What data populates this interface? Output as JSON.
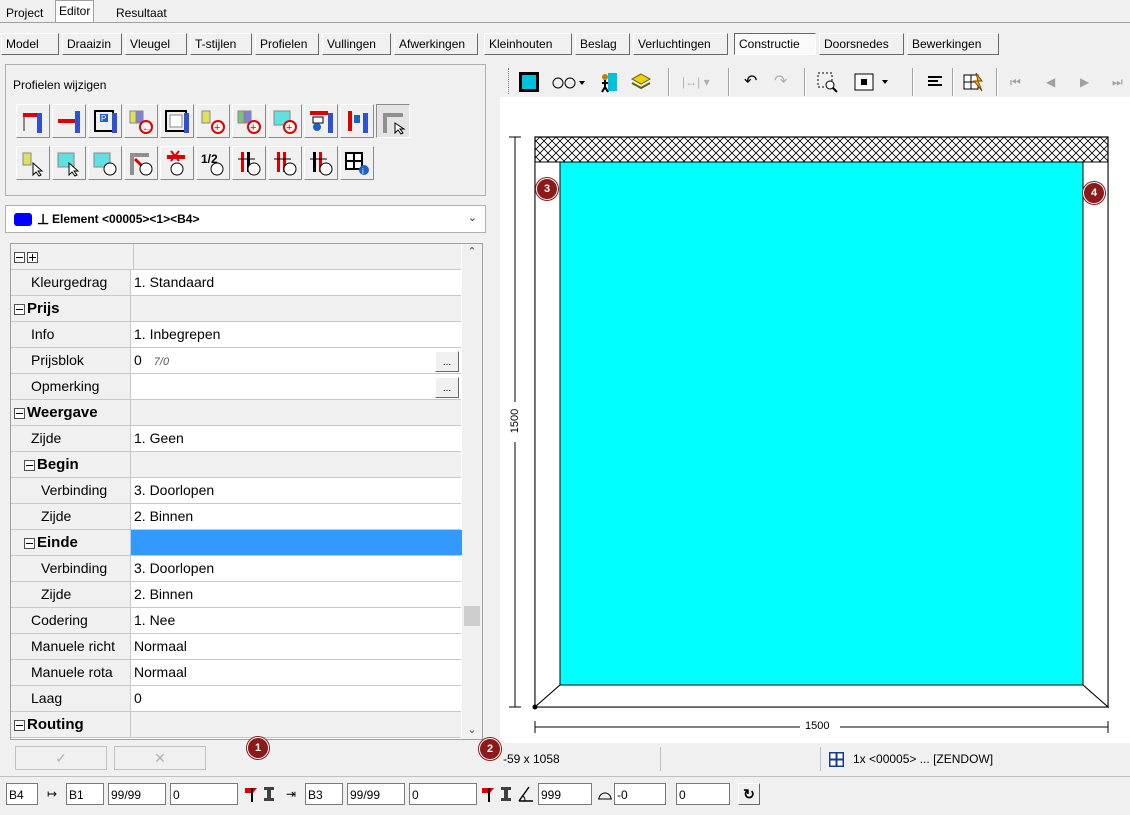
{
  "top_tabs": [
    "Project",
    "Editor",
    "Resultaat"
  ],
  "active_top_tab": "Editor",
  "module_tabs": [
    "Model",
    "Draaizin",
    "Vleugel",
    "T-stijlen",
    "Profielen",
    "Vullingen",
    "Afwerkingen",
    "Kleinhouten",
    "Beslag",
    "Verluchtingen",
    "Constructie",
    "Doorsnedes",
    "Bewerkingen"
  ],
  "active_module_tab": "Constructie",
  "left_panel": {
    "title": "Profielen wijzigen",
    "element_dropdown": "Element <00005><1><B4>"
  },
  "property_grid": {
    "rows": [
      {
        "name": "Kleurgedrag",
        "value": "1. Standaard",
        "type": "prop",
        "indent": 1
      },
      {
        "name": "Prijs",
        "value": "",
        "type": "cat",
        "indent": 0
      },
      {
        "name": "Info",
        "value": "1. Inbegrepen",
        "type": "prop",
        "indent": 1
      },
      {
        "name": "Prijsblok",
        "value": "0",
        "extra": "7/0",
        "type": "prop",
        "indent": 1,
        "button": "..."
      },
      {
        "name": "Opmerking",
        "value": "",
        "type": "prop",
        "indent": 1,
        "button": "..."
      },
      {
        "name": "Weergave",
        "value": "",
        "type": "cat",
        "indent": 0
      },
      {
        "name": "Zijde",
        "value": "1. Geen",
        "type": "prop",
        "indent": 1
      },
      {
        "name": "Begin",
        "value": "",
        "type": "cat",
        "indent": 1
      },
      {
        "name": "Verbinding",
        "value": "3. Doorlopen",
        "type": "prop",
        "indent": 2
      },
      {
        "name": "Zijde",
        "value": "2. Binnen",
        "type": "prop",
        "indent": 2
      },
      {
        "name": "Einde",
        "value": "",
        "type": "cat",
        "indent": 1,
        "selected": true
      },
      {
        "name": "Verbinding",
        "value": "3. Doorlopen",
        "type": "prop",
        "indent": 2
      },
      {
        "name": "Zijde",
        "value": "2. Binnen",
        "type": "prop",
        "indent": 2
      },
      {
        "name": "Codering",
        "value": "1. Nee",
        "type": "prop",
        "indent": 1
      },
      {
        "name": "Manuele richt",
        "value": "Normaal",
        "type": "prop",
        "indent": 1
      },
      {
        "name": "Manuele rota",
        "value": "Normaal",
        "type": "prop",
        "indent": 1
      },
      {
        "name": "Laag",
        "value": "0",
        "type": "prop",
        "indent": 1
      },
      {
        "name": "Routing",
        "value": "",
        "type": "cat",
        "indent": 0
      }
    ]
  },
  "drawing": {
    "dimension_horizontal": "1500",
    "dimension_vertical": "1500",
    "glass_color": "#00ffff",
    "markers": [
      "3",
      "4"
    ]
  },
  "callouts": [
    "1",
    "2"
  ],
  "status": {
    "coords": "-59 x 1058",
    "selection": "1x <00005> ... [ZENDOW]"
  },
  "bottom_bar": {
    "profile_left": "B4",
    "start_ref": "B1",
    "start_ratio": "99/99",
    "start_value": "0",
    "end_ref": "B3",
    "end_ratio": "99/99",
    "end_value": "0",
    "angle": "999",
    "rotation": "-0",
    "last_value": "0"
  },
  "colors": {
    "accent_selected": "#3399ff",
    "callout": "#8b1a1a",
    "element_swatch": "#0000ff"
  }
}
